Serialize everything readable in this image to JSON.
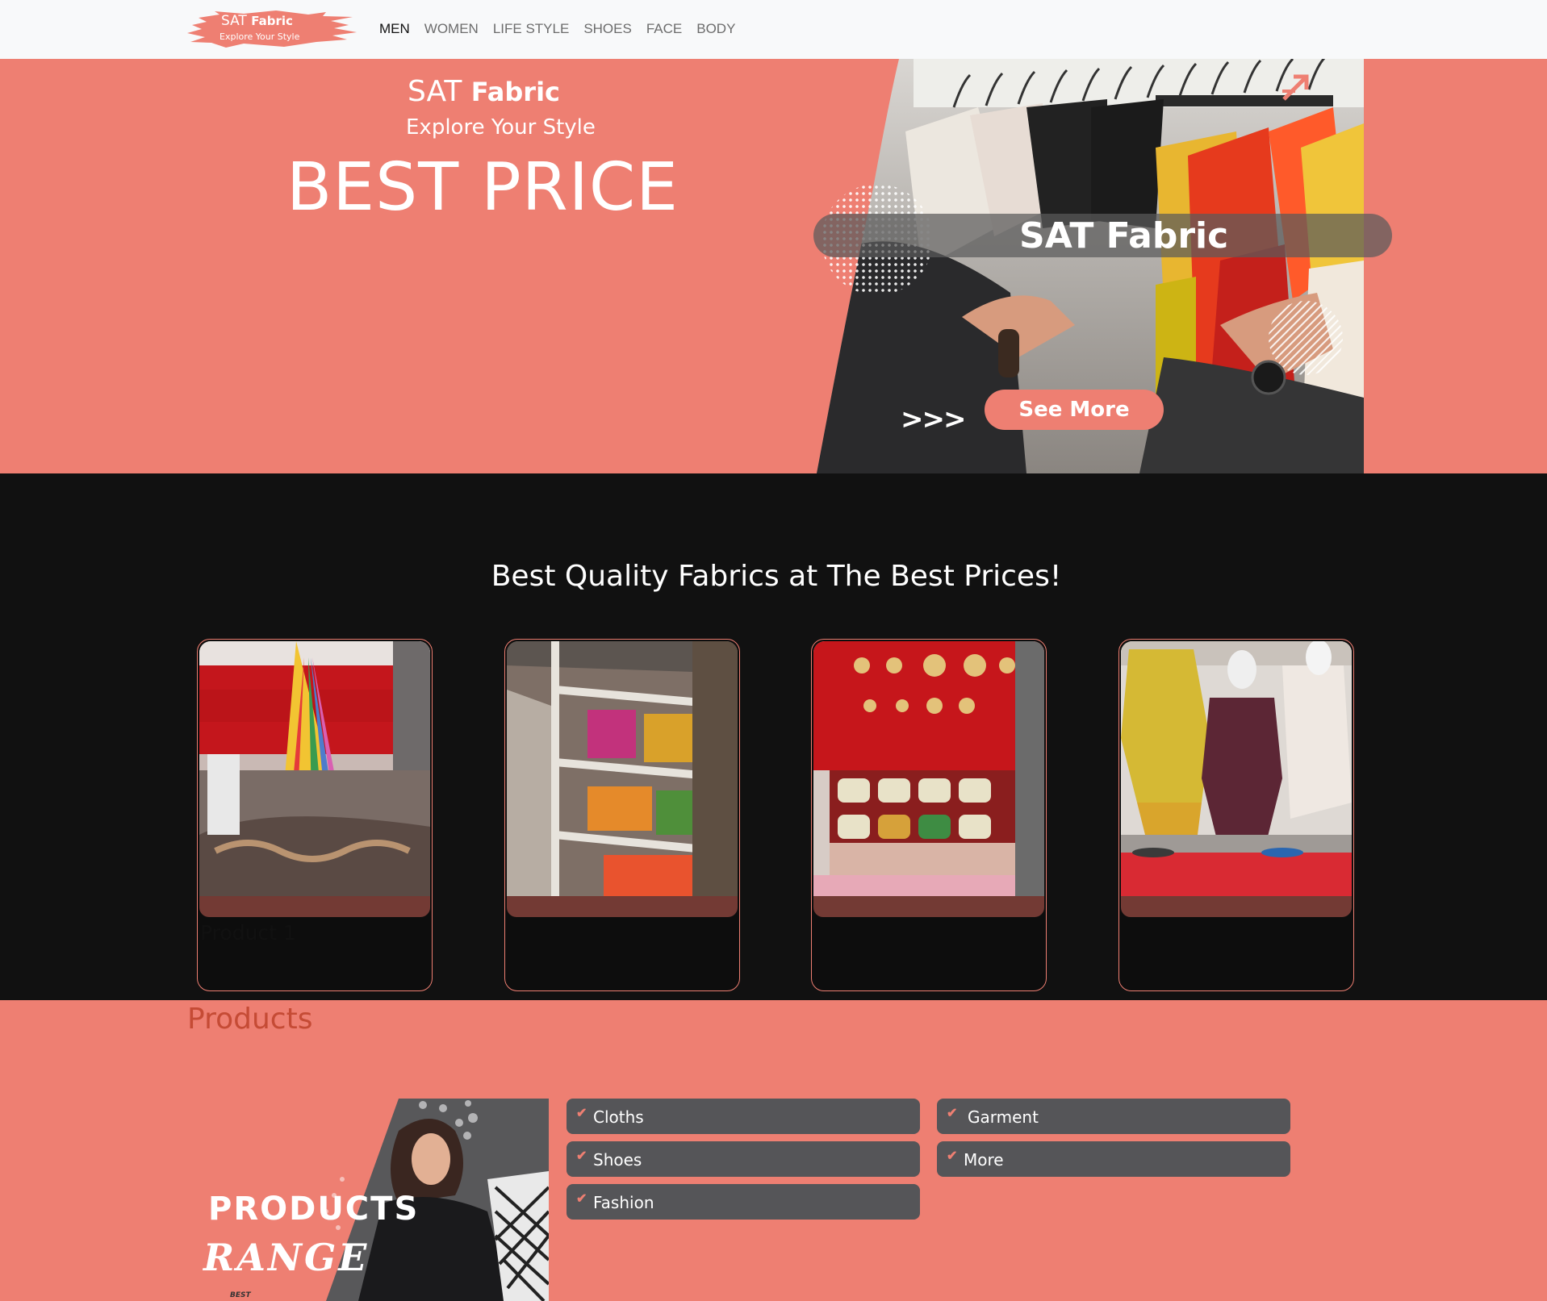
{
  "logo": {
    "brand": "SAT",
    "brand_bold": "Fabric",
    "tagline": "Explore Your Style"
  },
  "nav": {
    "items": [
      {
        "label": "MEN"
      },
      {
        "label": "WOMEN"
      },
      {
        "label": "LIFE STYLE"
      },
      {
        "label": "SHOES"
      },
      {
        "label": "FACE"
      },
      {
        "label": "BODY"
      }
    ]
  },
  "hero": {
    "brand": "SAT",
    "brand_bold": "Fabric",
    "tagline": "Explore Your Style",
    "headline": "BEST PRICE",
    "banner_text": "SAT Fabric",
    "chevrons": ">>>",
    "cta_label": "See More"
  },
  "section": {
    "heading": "Best Quality Fabrics at The Best Prices!",
    "cards": [
      {
        "title": "Product 1"
      },
      {
        "title": ""
      },
      {
        "title": ""
      },
      {
        "title": ""
      }
    ]
  },
  "products": {
    "heading": "Products",
    "range_title_1": "PRODUCTS",
    "range_title_2": "RANGE",
    "range_small": "BEST",
    "categories": [
      {
        "label": "Cloths"
      },
      {
        "label": "Garment"
      },
      {
        "label": "Shoes"
      },
      {
        "label": "More"
      },
      {
        "label": "Fashion"
      }
    ]
  },
  "colors": {
    "accent": "#ee7f72",
    "dark": "#111111",
    "navbar": "#f8f9fa",
    "category_bg": "#555558"
  },
  "icons": {
    "check": "check-icon",
    "arrows": "double-arrow-icon"
  }
}
